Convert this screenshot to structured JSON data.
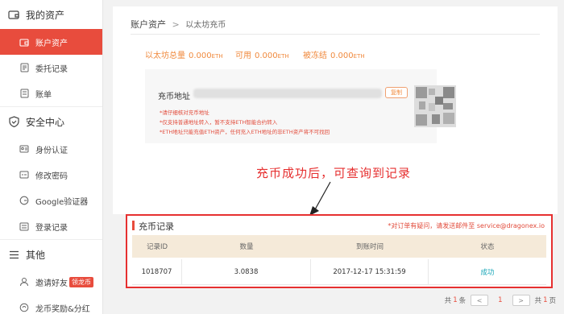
{
  "sidebar": {
    "assets": {
      "title": "我的资产",
      "items": [
        {
          "label": "账户资产",
          "active": true
        },
        {
          "label": "委托记录"
        },
        {
          "label": "账单"
        }
      ]
    },
    "security": {
      "title": "安全中心",
      "items": [
        {
          "label": "身份认证"
        },
        {
          "label": "修改密码"
        },
        {
          "label": "Google验证器"
        },
        {
          "label": "登录记录"
        }
      ]
    },
    "other": {
      "title": "其他",
      "items": [
        {
          "label": "邀请好友",
          "badge": "领龙币"
        },
        {
          "label": "龙币奖励&分红"
        }
      ]
    }
  },
  "breadcrumb": {
    "parent": "账户资产",
    "separator": ">",
    "current": "以太坊充币"
  },
  "balances": [
    {
      "label": "以太坊总量",
      "value": "0.000",
      "unit": "ETH"
    },
    {
      "label": "可用",
      "value": "0.000",
      "unit": "ETH"
    },
    {
      "label": "被冻结",
      "value": "0.000",
      "unit": "ETH"
    }
  ],
  "deposit": {
    "address_label": "充币地址",
    "copy_label": "复制",
    "notes": [
      "*请仔细核对充币地址",
      "*仅支持普通地址转入，暂不支持ETH智能合约转入",
      "*ETH地址只能充值ETH资产，任何充入ETH地址的非ETH资产将不可找回"
    ]
  },
  "annotation": "充币成功后，可查询到记录",
  "records": {
    "title": "充币记录",
    "note": "*对订单有疑问，请发送邮件至 service@dragonex.io",
    "columns": [
      "记录ID",
      "数量",
      "到账时间",
      "状态"
    ],
    "rows": [
      {
        "id": "1018707",
        "amount": "3.0838",
        "time": "2017-12-17 15:31:59",
        "status": "成功"
      }
    ]
  },
  "pager": {
    "total_prefix": "共",
    "total_count": "1",
    "total_suffix": "条",
    "prev": "<",
    "current_page": "1",
    "next": ">",
    "pages_prefix": "共",
    "pages_count": "1",
    "pages_suffix": "页"
  },
  "colors": {
    "accent": "#e84c3d",
    "balance": "#f08a3e",
    "success": "#1aa7b8",
    "table_header": "#f5ead9"
  }
}
